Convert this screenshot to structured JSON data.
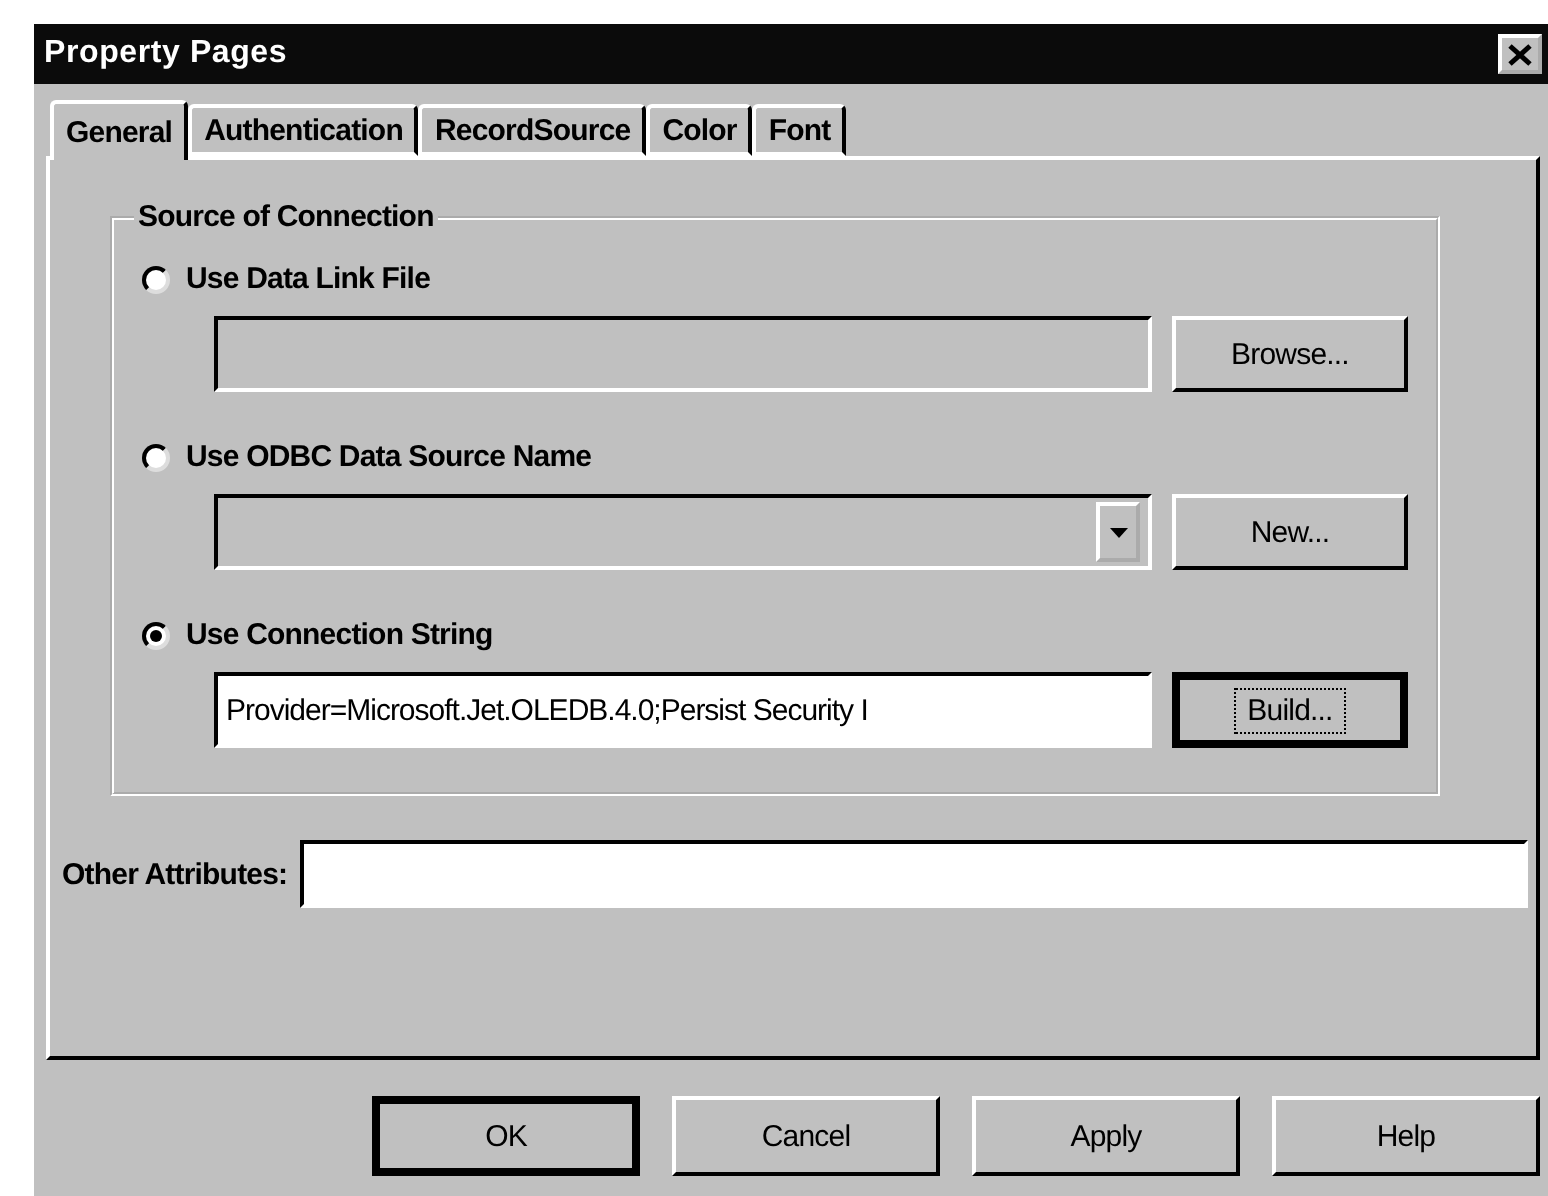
{
  "window": {
    "title": "Property Pages"
  },
  "tabs": [
    {
      "label": "General",
      "selected": true
    },
    {
      "label": "Authentication",
      "selected": false
    },
    {
      "label": "RecordSource",
      "selected": false
    },
    {
      "label": "Color",
      "selected": false
    },
    {
      "label": "Font",
      "selected": false
    }
  ],
  "group": {
    "title": "Source of Connection",
    "options": [
      {
        "label": "Use Data Link File",
        "selected": false,
        "field": {
          "kind": "text",
          "disabled": true
        },
        "button": {
          "label": "Browse...",
          "focused": false
        }
      },
      {
        "label": "Use ODBC Data Source Name",
        "selected": false,
        "field": {
          "kind": "combo",
          "disabled": true
        },
        "button": {
          "label": "New...",
          "focused": false
        }
      },
      {
        "label": "Use Connection String",
        "selected": true,
        "field": {
          "kind": "text",
          "disabled": false,
          "value": "Provider=Microsoft.Jet.OLEDB.4.0;Persist Security I"
        },
        "button": {
          "label": "Build...",
          "focused": true
        }
      }
    ]
  },
  "other_attributes": {
    "label": "Other Attributes:"
  },
  "buttons": [
    {
      "label": "OK",
      "default": true
    },
    {
      "label": "Cancel",
      "default": false
    },
    {
      "label": "Apply",
      "default": false
    },
    {
      "label": "Help",
      "default": false
    }
  ]
}
